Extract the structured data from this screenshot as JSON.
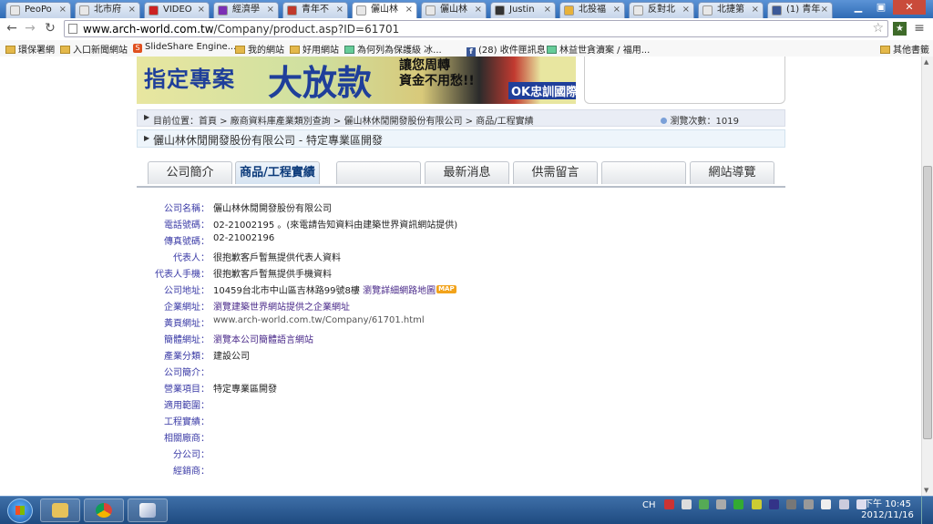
{
  "browser": {
    "tabs": [
      {
        "title": "PeoPo",
        "icon_color": "#e8e8e8"
      },
      {
        "title": "北市府",
        "icon_color": "#e8e8e8"
      },
      {
        "title": "VIDEO",
        "icon_color": "#cc2222"
      },
      {
        "title": "經濟學",
        "icon_color": "#7b2fb5"
      },
      {
        "title": "青年不",
        "icon_color": "#c0392b"
      },
      {
        "title": "儷山林",
        "icon_color": "#e8e8e8",
        "active": true
      },
      {
        "title": "儷山林",
        "icon_color": "#e8e8e8"
      },
      {
        "title": "Justin",
        "icon_color": "#333333"
      },
      {
        "title": "北投福",
        "icon_color": "#e8b23a"
      },
      {
        "title": "反對北",
        "icon_color": "#e8e8e8"
      },
      {
        "title": "北捷第",
        "icon_color": "#e8e8e8"
      },
      {
        "title": "(1) 青年",
        "icon_color": "#3b5998"
      }
    ],
    "url_host": "www.arch-world.com.tw",
    "url_path": "/Company/product.asp?ID=61701",
    "bookmarks": [
      {
        "label": "環保署網",
        "type": "folder"
      },
      {
        "label": "入口新聞網站",
        "type": "folder"
      },
      {
        "label": "SlideShare Engine...",
        "type": "ss"
      },
      {
        "label": "我的網站",
        "type": "folder"
      },
      {
        "label": "好用網站",
        "type": "folder"
      },
      {
        "label": "為何列為保護級 冰...",
        "type": "link"
      },
      {
        "label": "(28) 收件匣訊息",
        "type": "fb"
      },
      {
        "label": "林益世貪瀆案 / 福用...",
        "type": "link"
      },
      {
        "label": "其他書籤",
        "type": "folder"
      }
    ]
  },
  "banner": {
    "text1": "指定專案",
    "text2": "大放款",
    "text3": "讓您周轉",
    "text4": "資金不用愁!!",
    "text5": "OK忠訓國際"
  },
  "breadcrumb": {
    "text": "目前位置：首頁 > 廠商資料庫產業類別查詢 > 儷山林休閒開發股份有限公司 > 商品/工程實績",
    "views": "瀏覽次數：1019"
  },
  "page_title": "儷山林休閒開發股份有限公司 - 特定專業區開發",
  "site_tabs": [
    "公司簡介",
    "商品/工程實績",
    "",
    "最新消息",
    "供需留言",
    "",
    "網站導覽"
  ],
  "company": [
    {
      "label": "公司名稱：",
      "value": "儷山林休閒開發股份有限公司"
    },
    {
      "label": "電話號碼：",
      "value": "02-21002195 。(來電請告知資料由建築世界資訊網站提供)"
    },
    {
      "label": "傳真號碼：",
      "value": "02-21002196"
    },
    {
      "label": "代表人：",
      "value": "很抱歉客戶暫無提供代表人資料"
    },
    {
      "label": "代表人手機：",
      "value": "很抱歉客戶暫無提供手機資料"
    },
    {
      "label": "公司地址：",
      "value": "10459台北市中山區吉林路99號8樓",
      "link": "瀏覽詳細網路地圖",
      "badge": "MAP"
    },
    {
      "label": "企業網址：",
      "value": "",
      "link": "瀏覽建築世界網站提供之企業網址"
    },
    {
      "label": "黃頁網址：",
      "value": "",
      "link_gray": "www.arch-world.com.tw/Company/61701.html"
    },
    {
      "label": "簡體網址：",
      "value": "",
      "link": "瀏覽本公司簡體語言網站"
    },
    {
      "label": "產業分類：",
      "value": "建設公司"
    },
    {
      "label": "公司簡介：",
      "value": ""
    },
    {
      "label": "營業項目：",
      "value": "特定專業區開發"
    },
    {
      "label": "適用範圍：",
      "value": ""
    },
    {
      "label": "工程實績：",
      "value": ""
    },
    {
      "label": "相關廠商：",
      "value": ""
    },
    {
      "label": "分公司：",
      "value": ""
    },
    {
      "label": "經銷商：",
      "value": ""
    }
  ],
  "taskbar": {
    "lang": "CH",
    "time": "下午 10:45",
    "date": "2012/11/16"
  }
}
